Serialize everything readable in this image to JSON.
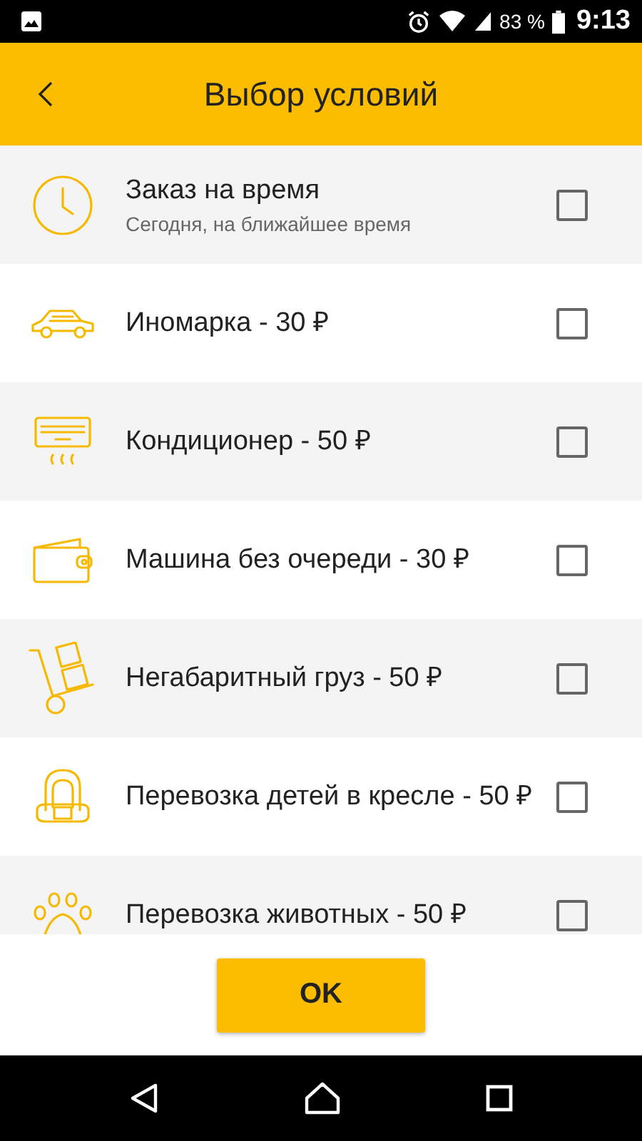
{
  "status_bar": {
    "battery": "83 %",
    "time": "9:13"
  },
  "app_bar": {
    "title": "Выбор условий"
  },
  "options": [
    {
      "label": "Заказ на время",
      "subtitle": "Сегодня, на ближайшее время",
      "checked": false
    },
    {
      "label": "Иномарка - 30 ₽",
      "checked": false
    },
    {
      "label": "Кондиционер - 50 ₽",
      "checked": false
    },
    {
      "label": "Машина без очереди - 30 ₽",
      "checked": false
    },
    {
      "label": "Негабаритный груз - 50 ₽",
      "checked": false
    },
    {
      "label": "Перевозка детей в кресле - 50 ₽",
      "checked": false
    },
    {
      "label": "Перевозка животных - 50 ₽",
      "checked": false
    }
  ],
  "ok_button": {
    "label": "OK"
  }
}
